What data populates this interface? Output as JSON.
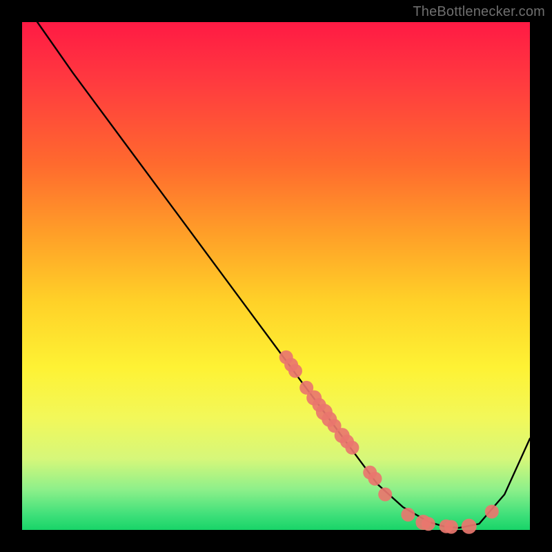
{
  "watermark": "TheBottlenecker.com",
  "chart_data": {
    "type": "line",
    "title": "",
    "xlabel": "",
    "ylabel": "",
    "xlim": [
      0,
      100
    ],
    "ylim": [
      0,
      100
    ],
    "x": [
      0,
      3,
      10,
      20,
      30,
      40,
      50,
      55,
      60,
      65,
      70,
      75,
      80,
      83,
      86,
      90,
      95,
      100
    ],
    "values": [
      108,
      100,
      90,
      76.5,
      63,
      49.5,
      36,
      29.2,
      22.5,
      15.7,
      9,
      4.5,
      1.6,
      0.7,
      0.4,
      1.2,
      7,
      18
    ],
    "points": [
      {
        "x": 52,
        "y": 34.0,
        "r": 10
      },
      {
        "x": 53,
        "y": 32.5,
        "r": 10
      },
      {
        "x": 53.8,
        "y": 31.3,
        "r": 10
      },
      {
        "x": 56.0,
        "y": 28.0,
        "r": 10
      },
      {
        "x": 57.5,
        "y": 26.0,
        "r": 11
      },
      {
        "x": 58.5,
        "y": 24.6,
        "r": 10
      },
      {
        "x": 59.5,
        "y": 23.2,
        "r": 12
      },
      {
        "x": 60.5,
        "y": 21.8,
        "r": 11
      },
      {
        "x": 61.5,
        "y": 20.5,
        "r": 10
      },
      {
        "x": 63.0,
        "y": 18.6,
        "r": 11
      },
      {
        "x": 64.0,
        "y": 17.4,
        "r": 10
      },
      {
        "x": 65.0,
        "y": 16.2,
        "r": 10
      },
      {
        "x": 68.5,
        "y": 11.3,
        "r": 10
      },
      {
        "x": 69.5,
        "y": 10.1,
        "r": 10
      },
      {
        "x": 71.5,
        "y": 7.0,
        "r": 10
      },
      {
        "x": 76.0,
        "y": 3.0,
        "r": 10
      },
      {
        "x": 79.0,
        "y": 1.5,
        "r": 11
      },
      {
        "x": 80.0,
        "y": 1.2,
        "r": 10
      },
      {
        "x": 83.5,
        "y": 0.7,
        "r": 10
      },
      {
        "x": 84.5,
        "y": 0.6,
        "r": 10
      },
      {
        "x": 88.0,
        "y": 0.7,
        "r": 11
      },
      {
        "x": 92.5,
        "y": 3.6,
        "r": 10
      }
    ],
    "point_color": "#e9766e"
  }
}
